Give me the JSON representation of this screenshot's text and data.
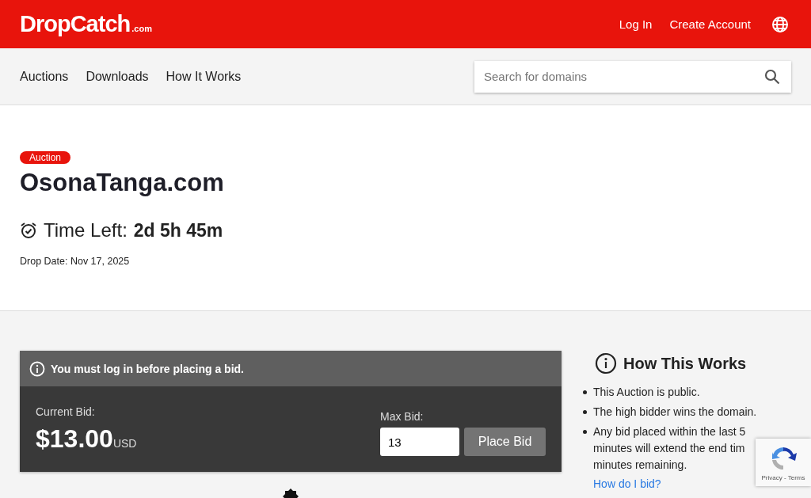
{
  "header": {
    "logo": "DropCatch",
    "logo_suffix": ".com",
    "links": [
      "Log In",
      "Create Account"
    ]
  },
  "nav": {
    "items": [
      "Auctions",
      "Downloads",
      "How It Works"
    ],
    "search": {
      "placeholder": "Search for domains"
    }
  },
  "listing": {
    "badge": "Auction",
    "domain": "OsonaTanga.com",
    "time_left_label": "Time Left:",
    "time_left": "2d 5h 45m",
    "drop_date": "Drop Date: Nov 17, 2025"
  },
  "bid_panel": {
    "notice": "You must log in before placing a bid.",
    "current_bid_label": "Current Bid:",
    "current_bid": "$13.00",
    "currency": "USD",
    "max_bid_label": "Max Bid:",
    "max_bid_value": "13",
    "button": "Place Bid"
  },
  "how_it_works": {
    "title": "How This Works",
    "items": [
      {
        "lines": [
          "This Auction is public."
        ]
      },
      {
        "lines": [
          "The high bidder wins the domain."
        ]
      },
      {
        "lines": [
          "Any bid placed within the last 5",
          "minutes will extend the end tim",
          "minutes remaining."
        ]
      }
    ],
    "link": "How do I bid?"
  },
  "recaptcha": {
    "links": "Privacy - Terms"
  }
}
